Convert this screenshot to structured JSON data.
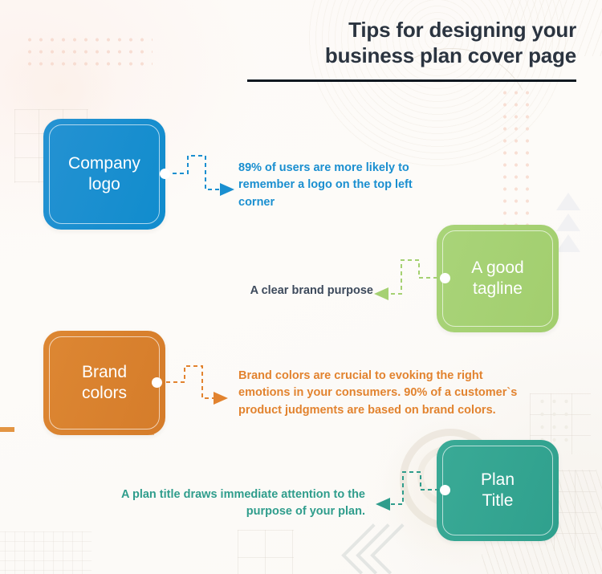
{
  "header": {
    "title_line1": "Tips for designing your",
    "title_line2": "business plan cover page"
  },
  "colors": {
    "background": "#fdfbf9",
    "title": "#2b3440",
    "rule": "#101820",
    "blue": "#1a8fd0",
    "green": "#a5d172",
    "orange": "#d8812f",
    "teal": "#35a592",
    "navy_text": "#3d4a5c"
  },
  "cards": [
    {
      "id": "company-logo",
      "label_line1": "Company",
      "label_line2": "logo",
      "color": "#1a8fd0",
      "side": "left",
      "body": "89% of users are more likely to remember a logo on the top left corner",
      "body_color": "#1a8fd0",
      "arrow_direction": "right"
    },
    {
      "id": "a-good-tagline",
      "label_line1": "A good",
      "label_line2": "tagline",
      "color": "#a5d172",
      "side": "right",
      "body": "A clear brand purpose",
      "body_color": "#3d4a5c",
      "arrow_direction": "left"
    },
    {
      "id": "brand-colors",
      "label_line1": "Brand",
      "label_line2": "colors",
      "color": "#d8812f",
      "side": "left",
      "body": "Brand colors are crucial to evoking the right emotions in your consumers. 90% of a customer`s product judgments are based on brand colors.",
      "body_color": "#e2832f",
      "arrow_direction": "right"
    },
    {
      "id": "plan-title",
      "label_line1": "Plan",
      "label_line2": "Title",
      "color": "#35a592",
      "side": "right",
      "body": "A plan title draws immediate attention to the purpose of your plan.",
      "body_color": "#2f9d8c",
      "arrow_direction": "left"
    }
  ],
  "decorations": {
    "dot_grid": "dot-grid-pattern",
    "square_grid": "square-grid-pattern",
    "triangles": "triangle-stack",
    "chevrons": "chevron-left-stack",
    "concentric_rings": "concentric-rings",
    "diagonal_stripes": "diagonal-stripes"
  }
}
